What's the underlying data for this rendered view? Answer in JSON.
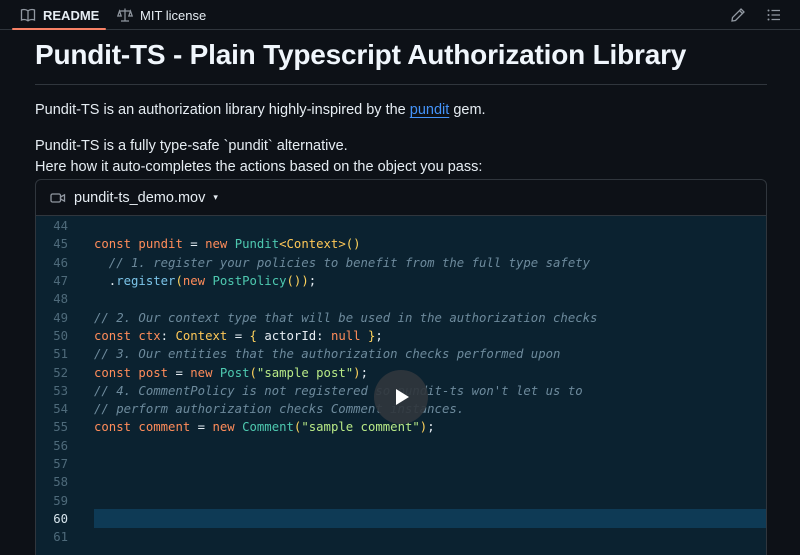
{
  "tabs": {
    "readme": "README",
    "license": "MIT license"
  },
  "icons": {
    "readme": "book-icon",
    "license": "scale-icon",
    "edit": "pencil-icon",
    "toc": "list-icon",
    "video": "video-camera-icon",
    "play": "play-icon"
  },
  "title": "Pundit-TS - Plain Typescript Authorization Library",
  "intro": {
    "before": "Pundit-TS is an authorization library highly-inspired by the ",
    "link": "pundit",
    "after": " gem."
  },
  "line2": "Pundit-TS is a fully type-safe `pundit` alternative.",
  "line3": "Here how it auto-completes the actions based on the object you pass:",
  "video": {
    "filename": "pundit-ts_demo.mov",
    "caret": "▾"
  },
  "colors": {
    "accent": "#f78166",
    "link": "#4493f8",
    "background": "#0d1117",
    "code_bg": "#0b2230"
  },
  "code": {
    "active_line": "60",
    "lines": [
      {
        "n": "44",
        "t": []
      },
      {
        "n": "45",
        "t": [
          [
            "kw",
            "const "
          ],
          [
            "var",
            "pundit "
          ],
          [
            "pl",
            "= "
          ],
          [
            "kw",
            "new "
          ],
          [
            "cls",
            "Pundit"
          ],
          [
            "ty",
            "<Context>"
          ],
          [
            "br",
            "()"
          ]
        ]
      },
      {
        "n": "46",
        "t": [
          [
            "cm",
            "  // 1. register your policies to benefit from the full type safety"
          ]
        ]
      },
      {
        "n": "47",
        "t": [
          [
            "pl",
            "  ."
          ],
          [
            "fn",
            "register"
          ],
          [
            "br",
            "("
          ],
          [
            "kw",
            "new "
          ],
          [
            "cls",
            "PostPolicy"
          ],
          [
            "br",
            "()"
          ],
          [
            "br",
            ")"
          ],
          [
            "pl",
            ";"
          ]
        ]
      },
      {
        "n": "48",
        "t": []
      },
      {
        "n": "49",
        "t": [
          [
            "cm",
            "// 2. Our context type that will be used in the authorization checks"
          ]
        ]
      },
      {
        "n": "50",
        "t": [
          [
            "kw",
            "const "
          ],
          [
            "var",
            "ctx"
          ],
          [
            "pl",
            ": "
          ],
          [
            "ty",
            "Context "
          ],
          [
            "pl",
            "= "
          ],
          [
            "br",
            "{ "
          ],
          [
            "pl",
            "actorId: "
          ],
          [
            "kw",
            "null "
          ],
          [
            "br",
            "}"
          ],
          [
            "pl",
            ";"
          ]
        ]
      },
      {
        "n": "51",
        "t": [
          [
            "cm",
            "// 3. Our entities that the authorization checks performed upon"
          ]
        ]
      },
      {
        "n": "52",
        "t": [
          [
            "kw",
            "const "
          ],
          [
            "var",
            "post "
          ],
          [
            "pl",
            "= "
          ],
          [
            "kw",
            "new "
          ],
          [
            "cls",
            "Post"
          ],
          [
            "br",
            "("
          ],
          [
            "str",
            "\"sample post\""
          ],
          [
            "br",
            ")"
          ],
          [
            "pl",
            ";"
          ]
        ]
      },
      {
        "n": "53",
        "t": [
          [
            "cm",
            "// 4. CommentPolicy is not registered so pundit-ts won't let us to"
          ]
        ]
      },
      {
        "n": "54",
        "t": [
          [
            "cm",
            "// perform authorization checks Comment instances."
          ]
        ]
      },
      {
        "n": "55",
        "t": [
          [
            "kw",
            "const "
          ],
          [
            "var",
            "comment "
          ],
          [
            "pl",
            "= "
          ],
          [
            "kw",
            "new "
          ],
          [
            "cls",
            "Comment"
          ],
          [
            "br",
            "("
          ],
          [
            "str",
            "\"sample comment\""
          ],
          [
            "br",
            ")"
          ],
          [
            "pl",
            ";"
          ]
        ]
      },
      {
        "n": "56",
        "t": []
      },
      {
        "n": "57",
        "t": []
      },
      {
        "n": "58",
        "t": []
      },
      {
        "n": "59",
        "t": []
      },
      {
        "n": "60",
        "t": []
      },
      {
        "n": "61",
        "t": []
      }
    ]
  }
}
